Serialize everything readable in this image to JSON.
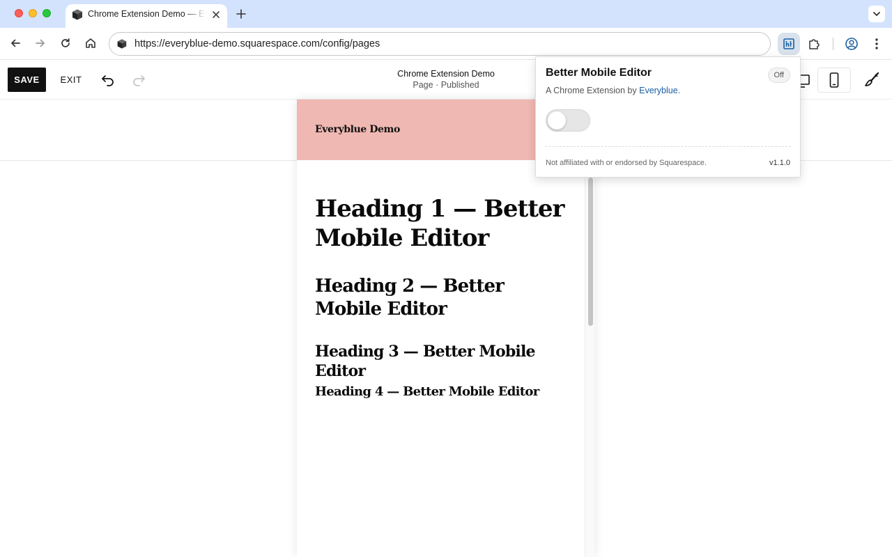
{
  "browser": {
    "tab": {
      "title": "Chrome Extension Demo — Everyblue Demo"
    },
    "address_bar": {
      "url": "https://everyblue-demo.squarespace.com/config/pages"
    }
  },
  "editor": {
    "save_label": "SAVE",
    "exit_label": "EXIT",
    "page_title": "Chrome Extension Demo",
    "page_status": "Page · Published"
  },
  "site": {
    "name": "Everyblue Demo",
    "header_color": "#f0b8b2",
    "headings": {
      "h1": "Heading 1 — Better Mobile Editor",
      "h2": "Heading 2 — Better Mobile Editor",
      "h3": "Heading 3 — Better Mobile Editor",
      "h4": "Heading 4 — Better Mobile Editor"
    }
  },
  "popup": {
    "title": "Better Mobile Editor",
    "status_badge": "Off",
    "subtitle_prefix": "A Chrome Extension by ",
    "subtitle_link": "Everyblue",
    "subtitle_suffix": ".",
    "toggle_on": false,
    "disclaimer": "Not affiliated with or endorsed by Squarespace.",
    "version": "v1.1.0"
  },
  "colors": {
    "tabstrip": "#d3e3fd",
    "link": "#1a5fa0",
    "save_button": "#111111"
  }
}
